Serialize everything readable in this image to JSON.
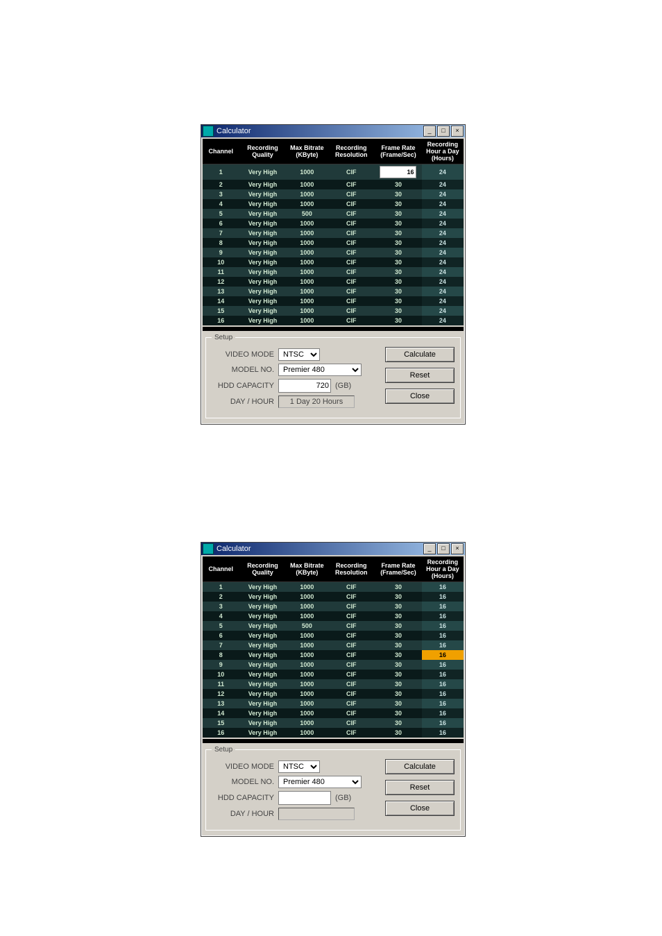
{
  "windows": [
    {
      "id": "win1",
      "title": "Calculator",
      "headers": [
        "Channel",
        "Recording Quality",
        "Max Bitrate (KByte)",
        "Recording Resolution",
        "Frame Rate (Frame/Sec)",
        "Recording Hour a Day (Hours)"
      ],
      "rows": [
        {
          "ch": "1",
          "quality": "Very High",
          "bitrate": "1000",
          "res": "CIF",
          "frame": "16",
          "frame_editing": true,
          "hours": "24"
        },
        {
          "ch": "2",
          "quality": "Very High",
          "bitrate": "1000",
          "res": "CIF",
          "frame": "30",
          "hours": "24"
        },
        {
          "ch": "3",
          "quality": "Very High",
          "bitrate": "1000",
          "res": "CIF",
          "frame": "30",
          "hours": "24"
        },
        {
          "ch": "4",
          "quality": "Very High",
          "bitrate": "1000",
          "res": "CIF",
          "frame": "30",
          "hours": "24"
        },
        {
          "ch": "5",
          "quality": "Very High",
          "bitrate": "500",
          "res": "CIF",
          "frame": "30",
          "hours": "24"
        },
        {
          "ch": "6",
          "quality": "Very High",
          "bitrate": "1000",
          "res": "CIF",
          "frame": "30",
          "hours": "24"
        },
        {
          "ch": "7",
          "quality": "Very High",
          "bitrate": "1000",
          "res": "CIF",
          "frame": "30",
          "hours": "24"
        },
        {
          "ch": "8",
          "quality": "Very High",
          "bitrate": "1000",
          "res": "CIF",
          "frame": "30",
          "hours": "24"
        },
        {
          "ch": "9",
          "quality": "Very High",
          "bitrate": "1000",
          "res": "CIF",
          "frame": "30",
          "hours": "24"
        },
        {
          "ch": "10",
          "quality": "Very High",
          "bitrate": "1000",
          "res": "CIF",
          "frame": "30",
          "hours": "24"
        },
        {
          "ch": "11",
          "quality": "Very High",
          "bitrate": "1000",
          "res": "CIF",
          "frame": "30",
          "hours": "24"
        },
        {
          "ch": "12",
          "quality": "Very High",
          "bitrate": "1000",
          "res": "CIF",
          "frame": "30",
          "hours": "24"
        },
        {
          "ch": "13",
          "quality": "Very High",
          "bitrate": "1000",
          "res": "CIF",
          "frame": "30",
          "hours": "24"
        },
        {
          "ch": "14",
          "quality": "Very High",
          "bitrate": "1000",
          "res": "CIF",
          "frame": "30",
          "hours": "24"
        },
        {
          "ch": "15",
          "quality": "Very High",
          "bitrate": "1000",
          "res": "CIF",
          "frame": "30",
          "hours": "24"
        },
        {
          "ch": "16",
          "quality": "Very High",
          "bitrate": "1000",
          "res": "CIF",
          "frame": "30",
          "hours": "24"
        }
      ],
      "setup": {
        "legend": "Setup",
        "video_mode_label": "VIDEO MODE",
        "video_mode_value": "NTSC",
        "model_no_label": "MODEL NO.",
        "model_no_value": "Premier 480",
        "hdd_capacity_label": "HDD CAPACITY",
        "hdd_capacity_value": "720",
        "hdd_unit": "(GB)",
        "day_hour_label": "DAY / HOUR",
        "day_hour_value": "1 Day 20 Hours",
        "calculate_label": "Calculate",
        "reset_label": "Reset",
        "close_label": "Close"
      }
    },
    {
      "id": "win2",
      "title": "Calculator",
      "headers": [
        "Channel",
        "Recording Quality",
        "Max Bitrate (KByte)",
        "Recording Resolution",
        "Frame Rate (Frame/Sec)",
        "Recording Hour a Day (Hours)"
      ],
      "rows": [
        {
          "ch": "1",
          "quality": "Very High",
          "bitrate": "1000",
          "res": "CIF",
          "frame": "30",
          "hours": "16"
        },
        {
          "ch": "2",
          "quality": "Very High",
          "bitrate": "1000",
          "res": "CIF",
          "frame": "30",
          "hours": "16"
        },
        {
          "ch": "3",
          "quality": "Very High",
          "bitrate": "1000",
          "res": "CIF",
          "frame": "30",
          "hours": "16"
        },
        {
          "ch": "4",
          "quality": "Very High",
          "bitrate": "1000",
          "res": "CIF",
          "frame": "30",
          "hours": "16"
        },
        {
          "ch": "5",
          "quality": "Very High",
          "bitrate": "500",
          "res": "CIF",
          "frame": "30",
          "hours": "16"
        },
        {
          "ch": "6",
          "quality": "Very High",
          "bitrate": "1000",
          "res": "CIF",
          "frame": "30",
          "hours": "16"
        },
        {
          "ch": "7",
          "quality": "Very High",
          "bitrate": "1000",
          "res": "CIF",
          "frame": "30",
          "hours": "16"
        },
        {
          "ch": "8",
          "quality": "Very High",
          "bitrate": "1000",
          "res": "CIF",
          "frame": "30",
          "hours": "16",
          "highlight": true
        },
        {
          "ch": "9",
          "quality": "Very High",
          "bitrate": "1000",
          "res": "CIF",
          "frame": "30",
          "hours": "16"
        },
        {
          "ch": "10",
          "quality": "Very High",
          "bitrate": "1000",
          "res": "CIF",
          "frame": "30",
          "hours": "16"
        },
        {
          "ch": "11",
          "quality": "Very High",
          "bitrate": "1000",
          "res": "CIF",
          "frame": "30",
          "hours": "16"
        },
        {
          "ch": "12",
          "quality": "Very High",
          "bitrate": "1000",
          "res": "CIF",
          "frame": "30",
          "hours": "16"
        },
        {
          "ch": "13",
          "quality": "Very High",
          "bitrate": "1000",
          "res": "CIF",
          "frame": "30",
          "hours": "16"
        },
        {
          "ch": "14",
          "quality": "Very High",
          "bitrate": "1000",
          "res": "CIF",
          "frame": "30",
          "hours": "16"
        },
        {
          "ch": "15",
          "quality": "Very High",
          "bitrate": "1000",
          "res": "CIF",
          "frame": "30",
          "hours": "16"
        },
        {
          "ch": "16",
          "quality": "Very High",
          "bitrate": "1000",
          "res": "CIF",
          "frame": "30",
          "hours": "16"
        }
      ],
      "setup": {
        "legend": "Setup",
        "video_mode_label": "VIDEO MODE",
        "video_mode_value": "NTSC",
        "model_no_label": "MODEL NO.",
        "model_no_value": "Premier 480",
        "hdd_capacity_label": "HDD CAPACITY",
        "hdd_capacity_value": "",
        "hdd_unit": "(GB)",
        "day_hour_label": "DAY / HOUR",
        "day_hour_value": "",
        "calculate_label": "Calculate",
        "reset_label": "Reset",
        "close_label": "Close"
      }
    }
  ],
  "win_btn_labels": {
    "min": "_",
    "max": "□",
    "close": "×"
  }
}
